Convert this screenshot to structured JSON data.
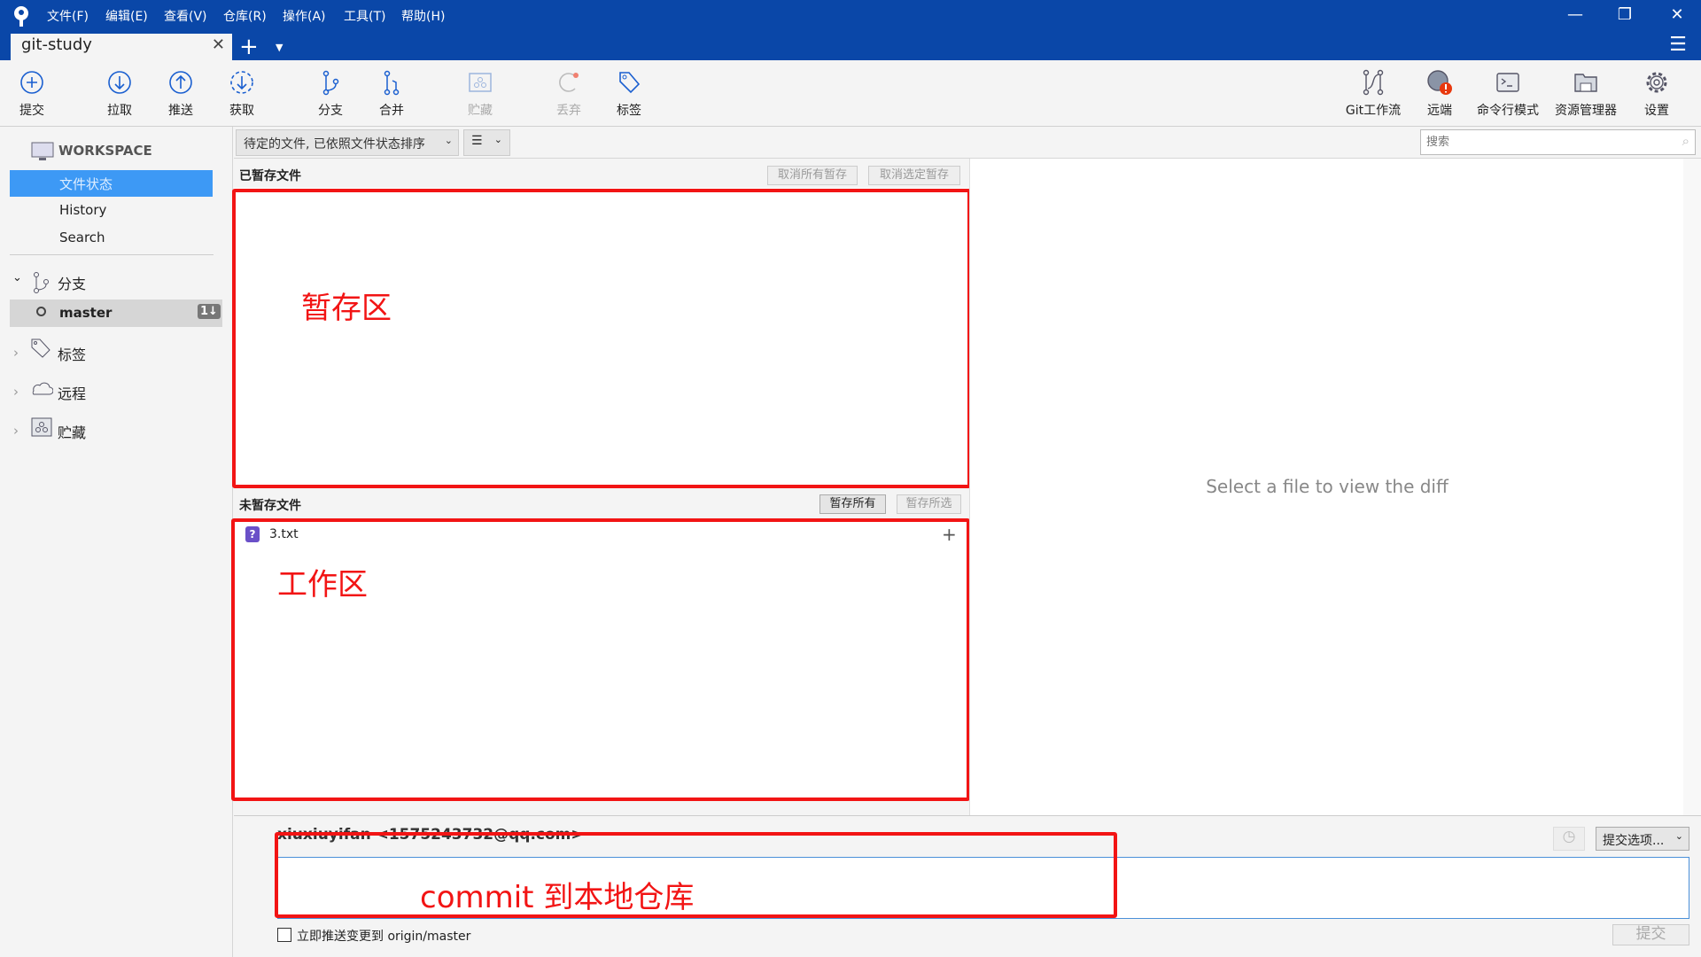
{
  "titlebar": {
    "menu": [
      "文件(F)",
      "编辑(E)",
      "查看(V)",
      "仓库(R)",
      "操作(A)",
      "工具(T)",
      "帮助(H)"
    ],
    "tab": "git-study"
  },
  "toolbar": {
    "left": [
      {
        "label": "提交",
        "icon": "commit-icon"
      },
      {
        "label": "拉取",
        "icon": "pull-icon"
      },
      {
        "label": "推送",
        "icon": "push-icon"
      },
      {
        "label": "获取",
        "icon": "fetch-icon"
      },
      {
        "label": "分支",
        "icon": "branch-icon"
      },
      {
        "label": "合并",
        "icon": "merge-icon"
      },
      {
        "label": "贮藏",
        "icon": "stash-icon",
        "disabled": true
      },
      {
        "label": "丢弃",
        "icon": "discard-icon",
        "disabled": true
      },
      {
        "label": "标签",
        "icon": "tag-icon"
      }
    ],
    "right": [
      {
        "label": "Git工作流"
      },
      {
        "label": "远端"
      },
      {
        "label": "命令行模式"
      },
      {
        "label": "资源管理器"
      },
      {
        "label": "设置"
      }
    ]
  },
  "sidebar": {
    "workspace": "WORKSPACE",
    "items": [
      "文件状态",
      "History",
      "Search"
    ],
    "branches": "分支",
    "branch": "master",
    "branch_badge": "1↓",
    "tags": "标签",
    "remotes": "远程",
    "stashes": "贮藏"
  },
  "filter": {
    "sort": "待定的文件, 已依照文件状态排序",
    "view": "☰",
    "search_placeholder": "搜索"
  },
  "staged": {
    "title": "已暂存文件",
    "unstage_all": "取消所有暂存",
    "unstage_selected": "取消选定暂存",
    "annotation": "暂存区"
  },
  "unstaged": {
    "title": "未暂存文件",
    "stage_all": "暂存所有",
    "stage_selected": "暂存所选",
    "files": [
      {
        "name": "3.txt",
        "status": "untracked"
      }
    ],
    "annotation": "工作区"
  },
  "diff": {
    "empty": "Select a file to view the diff"
  },
  "commit": {
    "author": "xiuxiuyifan <1575243732@qq.com>",
    "options": "提交选项...",
    "push_label": "立即推送变更到 origin/master",
    "submit": "提交",
    "annotation": "commit 到本地仓库"
  },
  "colors": {
    "titlebar": "#0a47a8",
    "accent": "#3d99f5",
    "annotation": "#f21414"
  }
}
